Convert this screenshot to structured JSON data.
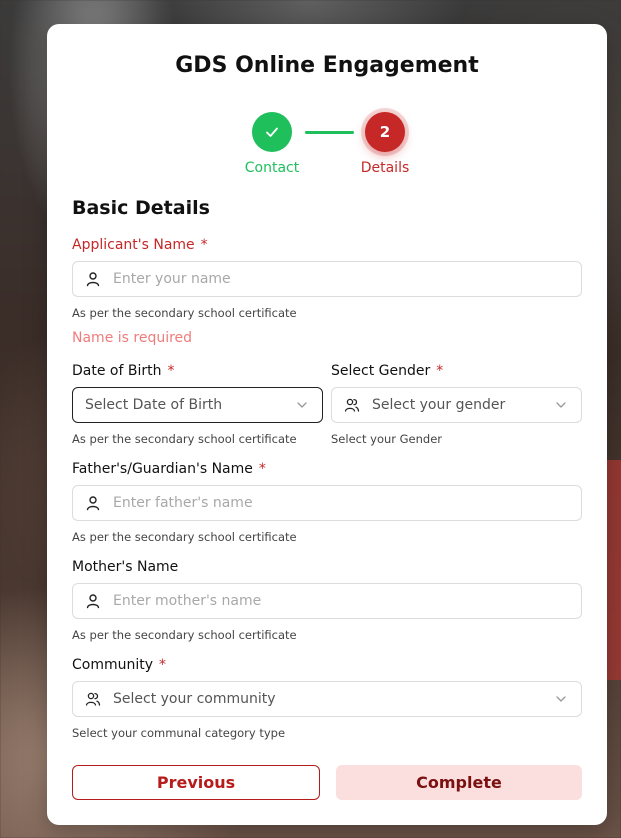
{
  "form": {
    "title": "GDS Online Engagement",
    "steps": [
      {
        "label": "Contact",
        "marker": "✓",
        "state": "done"
      },
      {
        "label": "Details",
        "marker": "2",
        "state": "active"
      }
    ],
    "section_title": "Basic Details",
    "required_mark": "*",
    "fields": {
      "applicant_name": {
        "label": "Applicant's Name",
        "placeholder": "Enter your name",
        "helper": "As per the secondary school certificate",
        "error": "Name is required",
        "icon": "user-icon"
      },
      "date_of_birth": {
        "label": "Date of Birth",
        "placeholder": "Select Date of Birth",
        "helper": "As per the secondary school certificate",
        "icon": "chevron-down-icon"
      },
      "gender": {
        "label": "Select Gender",
        "placeholder": "Select your gender",
        "helper": "Select your Gender",
        "icon": "users-icon"
      },
      "father_name": {
        "label": "Father's/Guardian's Name",
        "placeholder": "Enter father's name",
        "helper": "As per the secondary school certificate",
        "icon": "user-icon"
      },
      "mother_name": {
        "label": "Mother's Name",
        "placeholder": "Enter mother's name",
        "helper": "As per the secondary school certificate",
        "icon": "user-icon"
      },
      "community": {
        "label": "Community",
        "placeholder": "Select your community",
        "helper": "Select your communal category type",
        "icon": "users-icon"
      }
    },
    "buttons": {
      "previous": "Previous",
      "complete": "Complete"
    }
  },
  "colors": {
    "primary_red": "#c62828",
    "success_green": "#1fbf5c",
    "error_text": "#ef7c7c",
    "complete_bg": "#fbdede"
  }
}
